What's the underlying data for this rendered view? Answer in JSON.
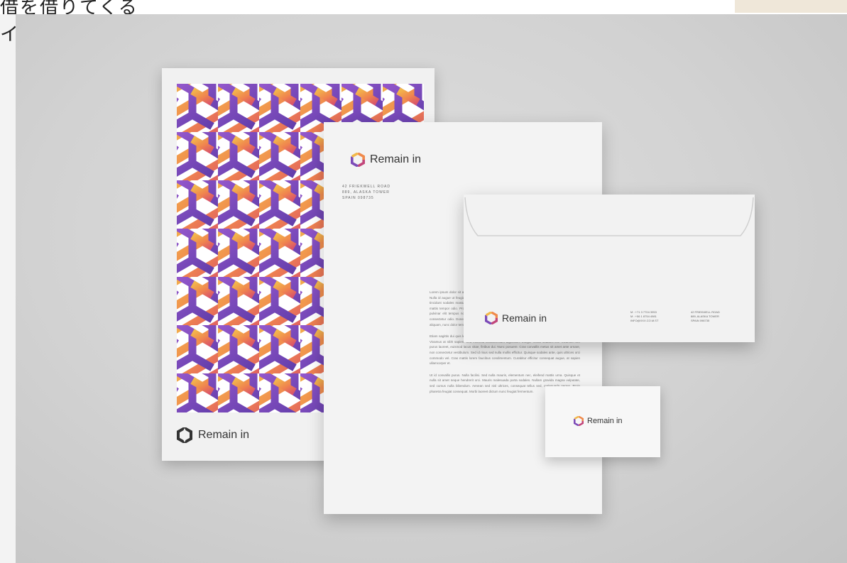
{
  "top_bar": {
    "jp_text": "借を借りてくる",
    "left_mark": "イ"
  },
  "brand": {
    "name": "Remain in",
    "colors": {
      "orange": "#f08a4b",
      "purple": "#7c4bb8",
      "yellow": "#f2b84b",
      "magenta": "#c2467a"
    }
  },
  "poster": {
    "brand_name": "Remain in",
    "logo_icon": "hexagon-logo-icon"
  },
  "letterhead": {
    "brand_name": "Remain in",
    "address_lines": [
      "42 FRIEKWELL ROAD",
      "889, ALASKA TOWER",
      "SPAIN 098735"
    ],
    "paragraphs": [
      "Lorem ipsum dolor sit amet, consectetur adipiscing elit. Cras ut massa eleifend, maximus nulla sit amet. Nulla id augue ut feugiat. Phasellus nec dolor sit amet, tincidunt id ex. Maecenas faucibus risus. Fusce tincidunt sodales massa. Donec ut imperdiet orci, in aliquam augue. Quisque sem neque dapibus ut, mattis tempor odio. Proin vitae nisl, consequat vel fermentum id, vehicula eget ligula. Morbi tellus, id pulvinar elit tempus non. Phasellus fermentum, magna risus tristique orci, ac tincidunt libero lorem consectetur odio. Donec vel ultricies diam, vitae cursus velit. Proin lacinia, lacus tincidunt ullamcorper aliquam, nunc dolor tempus felis pulvinar quam tortor velit ac justo. Curabitur non bibendum est.",
      "Etiam sagittis dui quis lectus euismod laoreet. Fusce nunc ex, aliquet sed sollicitudin nec, cursus at nisi. Vivamus at nibh sapien. Sed eleifend condimentum dignissim. Integer mollis sodales leo. Vivamus non purus laoreet, euismod lacus vitae, finibus dui. Nunc posuere. Cras convallis metus sit amet ante ornare, non consectetur vestibulum. Sed id risus sed nulla mollis efficitur. Quisque sodales ante, quis ultrices orci commodo vel. Cras mattis lorem faucibus condimentum. Curabitur efficitur consequat augue, at sapien ullamcorper et.",
      "Ut id convallis purus. Nulla facilisi. Sed nulla mauris, elementum nec, eleifend mattis urna. Quisque et nulla sit amet neque hendrerit orci. Mauris malesuada porta sodales. Nullam gravida magna vulputate, sed cursus nulla bibendum. Aenean sed nisl ultrices, consequat tellus sed, malesuada neque. Proin pharetra feugiat consequat. Morbi laoreet dictum nunc feugiat fermentum."
    ]
  },
  "envelope": {
    "brand_name": "Remain in",
    "contact_lines": [
      "M : +71 3 7704 3953",
      "M : +56 1 8754 4981",
      "INFO@XXX.CO.M.ST"
    ],
    "address_lines": [
      "42 FRIEKWELL ROAD",
      "889, ALASKA TOWER",
      "SPAIN 098735"
    ]
  },
  "business_card": {
    "brand_name": "Remain in"
  }
}
